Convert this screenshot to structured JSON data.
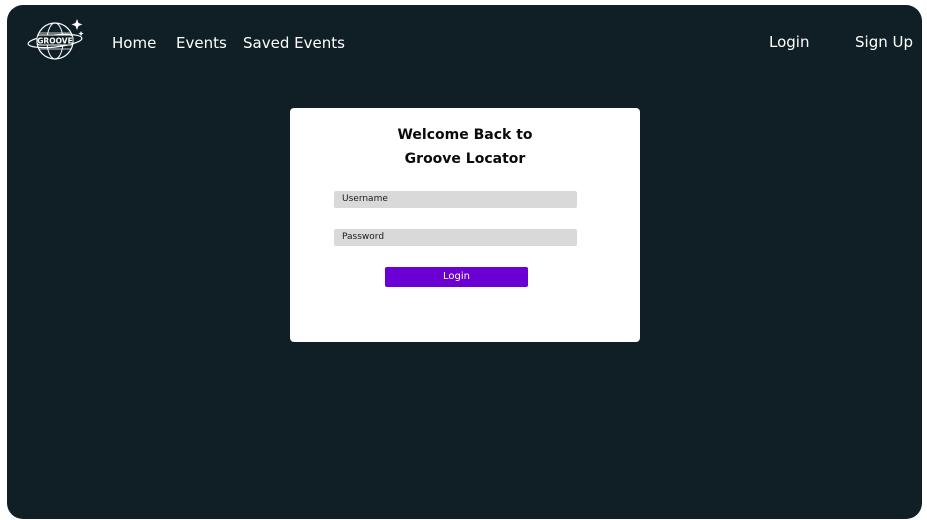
{
  "brand": {
    "logo_text": "GROOVE",
    "logo_icon": "globe-sparkle-icon"
  },
  "nav": {
    "home": "Home",
    "events": "Events",
    "saved_events": "Saved Events",
    "login": "Login",
    "sign_up": "Sign Up"
  },
  "login_card": {
    "title_line1": "Welcome Back to",
    "title_line2": "Groove Locator",
    "username_placeholder": "Username",
    "password_placeholder": "Password",
    "submit_label": "Login"
  },
  "colors": {
    "background": "#101f26",
    "card": "#ffffff",
    "input": "#d9d9d9",
    "accent": "#6a00d4"
  }
}
